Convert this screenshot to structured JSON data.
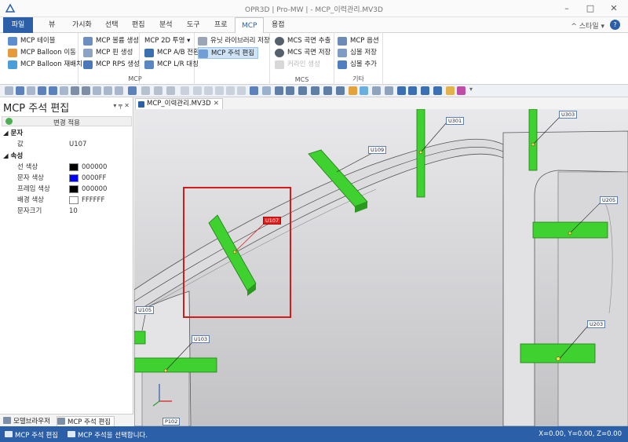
{
  "window": {
    "title": "OPR3D | Pro-MW | - MCP_이력관리.MV3D",
    "controls": [
      "–",
      "□",
      "✕"
    ]
  },
  "ribbon_tabs": {
    "file": "파일",
    "items": [
      "뷰",
      "가시화",
      "선택",
      "편집",
      "분석",
      "도구",
      "프로",
      "MCP",
      "용접"
    ],
    "active": "MCP",
    "help": "^ 스타일 ▾",
    "help_icon": "?"
  },
  "ribbon": {
    "group1": {
      "items": [
        "MCP 테이블",
        "MCP Balloon 이동",
        "MCP Balloon 재배치"
      ]
    },
    "group2": {
      "items": [
        "MCP 볼륨 생성",
        "MCP 핀 생성",
        "MCP RPS 생성"
      ]
    },
    "group3": {
      "items": [
        "MCP 2D 투영 ▾",
        "MCP A/B 전환",
        "MCP L/R 대칭"
      ]
    },
    "group4": {
      "items": [
        "유닛 라이브러리 저장",
        "MCP 주석 편집"
      ],
      "selected": "MCP 주석 편집"
    },
    "mcp_label": "MCP",
    "group5": {
      "items": [
        "MCS 곡면 추출",
        "MCS 곡면 저장",
        "커라인 생성"
      ],
      "label": "MCS"
    },
    "group6": {
      "items": [
        "MCP 옵션",
        "심볼 저장",
        "심볼 추가"
      ],
      "label": "기타"
    }
  },
  "panel": {
    "title": "MCP 주석 편집",
    "controls": "▾  ╤  ✕",
    "apply_label": "변경 적용",
    "section_text": "문자",
    "value_label": "값",
    "value": "U107",
    "section_props": "속성",
    "rows": [
      {
        "label": "선 색상",
        "color": "#000000",
        "value": "000000"
      },
      {
        "label": "문자 색상",
        "color": "#0000FF",
        "value": "0000FF"
      },
      {
        "label": "프레임 색상",
        "color": "#000000",
        "value": "000000"
      },
      {
        "label": "배경 색상",
        "color": "#FFFFFF",
        "value": "FFFFFF"
      }
    ],
    "font_size_label": "문자크기",
    "font_size": "10",
    "bottom_tabs": [
      "모델브라우저",
      "MCP 주석 편집"
    ]
  },
  "document_tab": {
    "label": "MCP_이력관리.MV3D",
    "close": "✕"
  },
  "viewport": {
    "labels": [
      "U301",
      "U303",
      "U109",
      "U107",
      "U205",
      "U105",
      "U103",
      "U203",
      "P102"
    ],
    "selected_label": "U107",
    "mcp_block_color": "#3fd12f",
    "selection_color": "#d61a1a"
  },
  "statusbar": {
    "mode": "MCP 주석 편집",
    "message": "MCP 주석을 선택합니다.",
    "coords": "X=0.00, Y=0.00, Z=0.00"
  }
}
